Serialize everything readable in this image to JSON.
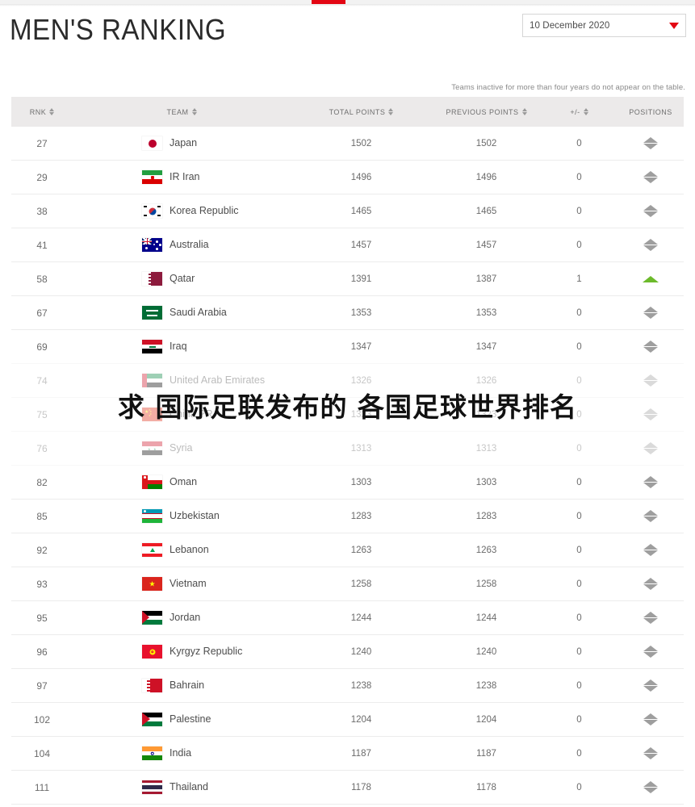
{
  "header": {
    "title": "MEN'S RANKING",
    "date_selected": "10 December 2020"
  },
  "note": "Teams inactive for more than four years do not appear on the table.",
  "columns": {
    "rnk": "RNK",
    "team": "TEAM",
    "total_points": "TOTAL POINTS",
    "previous_points": "PREVIOUS POINTS",
    "plus_minus": "+/-",
    "positions": "POSITIONS"
  },
  "overlay_text": "求 国际足联发布的 各国足球世界排名",
  "colors": {
    "accent_red": "#e30613",
    "up_green": "#6cba2b",
    "header_bg": "#eceaea",
    "text_gray": "#6b6b6b"
  },
  "rows": [
    {
      "rnk": "27",
      "team": "Japan",
      "flag": "flag-japan",
      "total": "1502",
      "prev": "1502",
      "pm": "0",
      "pos": "same"
    },
    {
      "rnk": "29",
      "team": "IR Iran",
      "flag": "flag-iran",
      "total": "1496",
      "prev": "1496",
      "pm": "0",
      "pos": "same"
    },
    {
      "rnk": "38",
      "team": "Korea Republic",
      "flag": "flag-korea",
      "total": "1465",
      "prev": "1465",
      "pm": "0",
      "pos": "same"
    },
    {
      "rnk": "41",
      "team": "Australia",
      "flag": "flag-australia",
      "total": "1457",
      "prev": "1457",
      "pm": "0",
      "pos": "same"
    },
    {
      "rnk": "58",
      "team": "Qatar",
      "flag": "flag-qatar",
      "total": "1391",
      "prev": "1387",
      "pm": "1",
      "pos": "up"
    },
    {
      "rnk": "67",
      "team": "Saudi Arabia",
      "flag": "flag-saudi",
      "total": "1353",
      "prev": "1353",
      "pm": "0",
      "pos": "same"
    },
    {
      "rnk": "69",
      "team": "Iraq",
      "flag": "flag-iraq",
      "total": "1347",
      "prev": "1347",
      "pm": "0",
      "pos": "same"
    },
    {
      "rnk": "74",
      "team": "United Arab Emirates",
      "flag": "flag-uae",
      "total": "1326",
      "prev": "1326",
      "pm": "0",
      "pos": "same"
    },
    {
      "rnk": "75",
      "team": "China PR",
      "flag": "flag-china",
      "total": "1323",
      "prev": "1323",
      "pm": "0",
      "pos": "same"
    },
    {
      "rnk": "76",
      "team": "Syria",
      "flag": "flag-syria",
      "total": "1313",
      "prev": "1313",
      "pm": "0",
      "pos": "same"
    },
    {
      "rnk": "82",
      "team": "Oman",
      "flag": "flag-oman",
      "total": "1303",
      "prev": "1303",
      "pm": "0",
      "pos": "same"
    },
    {
      "rnk": "85",
      "team": "Uzbekistan",
      "flag": "flag-uzbekistan",
      "total": "1283",
      "prev": "1283",
      "pm": "0",
      "pos": "same"
    },
    {
      "rnk": "92",
      "team": "Lebanon",
      "flag": "flag-lebanon",
      "total": "1263",
      "prev": "1263",
      "pm": "0",
      "pos": "same"
    },
    {
      "rnk": "93",
      "team": "Vietnam",
      "flag": "flag-vietnam",
      "total": "1258",
      "prev": "1258",
      "pm": "0",
      "pos": "same"
    },
    {
      "rnk": "95",
      "team": "Jordan",
      "flag": "flag-jordan",
      "total": "1244",
      "prev": "1244",
      "pm": "0",
      "pos": "same"
    },
    {
      "rnk": "96",
      "team": "Kyrgyz Republic",
      "flag": "flag-kyrgyz",
      "total": "1240",
      "prev": "1240",
      "pm": "0",
      "pos": "same"
    },
    {
      "rnk": "97",
      "team": "Bahrain",
      "flag": "flag-bahrain",
      "total": "1238",
      "prev": "1238",
      "pm": "0",
      "pos": "same"
    },
    {
      "rnk": "102",
      "team": "Palestine",
      "flag": "flag-palestine",
      "total": "1204",
      "prev": "1204",
      "pm": "0",
      "pos": "same"
    },
    {
      "rnk": "104",
      "team": "India",
      "flag": "flag-india",
      "total": "1187",
      "prev": "1187",
      "pm": "0",
      "pos": "same"
    },
    {
      "rnk": "111",
      "team": "Thailand",
      "flag": "flag-thailand",
      "total": "1178",
      "prev": "1178",
      "pm": "0",
      "pos": "same"
    }
  ]
}
